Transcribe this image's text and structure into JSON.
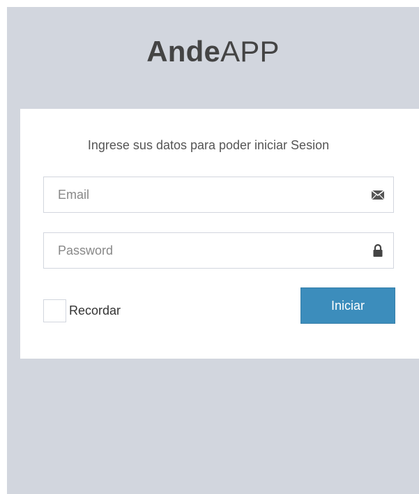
{
  "logo": {
    "bold_part": "Ande",
    "light_part": "APP"
  },
  "login_box": {
    "message": "Ingrese sus datos para poder iniciar Sesion",
    "email": {
      "placeholder": "Email",
      "value": "",
      "icon": "envelope-icon"
    },
    "password": {
      "placeholder": "Password",
      "value": "",
      "icon": "lock-icon"
    },
    "remember": {
      "label": "Recordar",
      "checked": false
    },
    "submit_label": "Iniciar"
  },
  "colors": {
    "background": "#d2d6de",
    "box": "#ffffff",
    "button": "#3c8dbc",
    "text": "#444444"
  }
}
